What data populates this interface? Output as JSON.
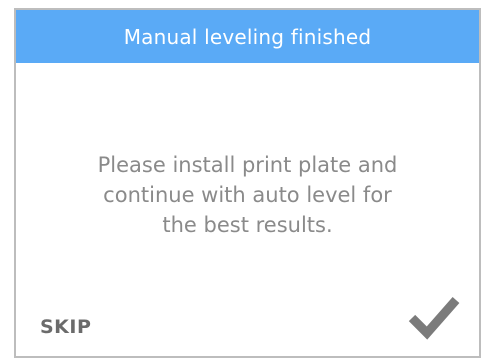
{
  "dialog": {
    "title": "Manual leveling finished",
    "message_lines": [
      "Please install print plate and",
      "continue with auto level for",
      "the best results."
    ],
    "skip_label": "SKIP",
    "confirm_icon": "checkmark-icon",
    "colors": {
      "header_bg": "#5aaaf6",
      "header_text": "#ffffff",
      "body_text": "#8a8a8a",
      "skip_text": "#6b6b6b",
      "check": "#7b7b7b",
      "border": "#bdbdbd"
    }
  }
}
